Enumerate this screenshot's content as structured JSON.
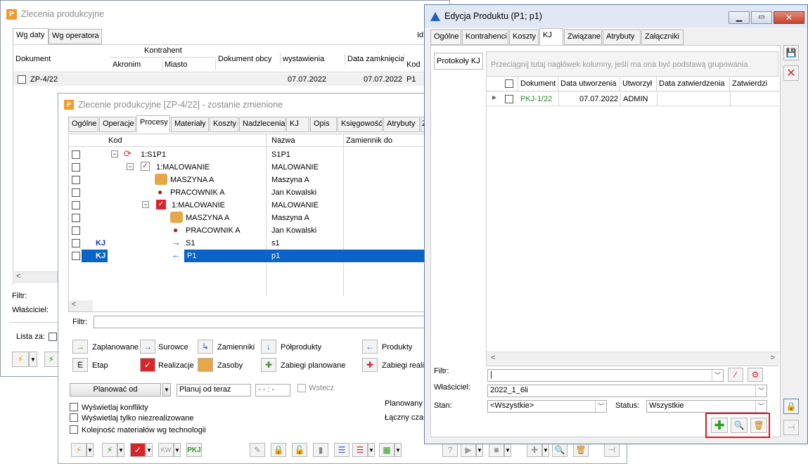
{
  "win1": {
    "title": "Zlecenia produkcyjne",
    "tabs": [
      "Wg daty",
      "Wg operatora"
    ],
    "right_label": "Id",
    "columns": {
      "dokument": "Dokument",
      "kontrahent": "Kontrahent",
      "akronim": "Akronim",
      "miasto": "Miasto",
      "dokument_obcy": "Dokument obcy",
      "wystawienia": "wystawienia",
      "data_zamkniecia": "Data zamknięcia",
      "kod": "Kod"
    },
    "row": {
      "dokument": "ZP-4/22",
      "wystawienia": "07.07.2022",
      "zamkniecia": "07.07.2022",
      "kod": "P1"
    },
    "filtr_label": "Filtr:",
    "wlasciciel_label": "Właściciel:",
    "lista_label": "Lista za:"
  },
  "win2": {
    "title": "Zlecenie produkcyjne  [ZP-4/22] - zostanie zmienione",
    "tabs": [
      "Ogólne",
      "Operacje",
      "Procesy",
      "Materiały",
      "Koszty",
      "Nadzlecenia",
      "KJ",
      "Opis",
      "Księgowość",
      "Atrybuty",
      "Z"
    ],
    "columns": {
      "kod": "Kod",
      "nazwa": "Nazwa",
      "zamiennik": "Zamiennik do"
    },
    "tree": [
      {
        "kod": "1:S1P1",
        "nazwa": "S1P1",
        "kj": ""
      },
      {
        "kod": "1:MALOWANIE",
        "nazwa": "MALOWANIE",
        "kj": ""
      },
      {
        "kod": "MASZYNA A",
        "nazwa": "Maszyna A",
        "kj": ""
      },
      {
        "kod": "PRACOWNIK A",
        "nazwa": "Jan Kowalski",
        "kj": ""
      },
      {
        "kod": "1:MALOWANIE",
        "nazwa": "MALOWANIE",
        "kj": ""
      },
      {
        "kod": "MASZYNA A",
        "nazwa": "Maszyna A",
        "kj": ""
      },
      {
        "kod": "PRACOWNIK A",
        "nazwa": "Jan Kowalski",
        "kj": ""
      },
      {
        "kod": "S1",
        "nazwa": "s1",
        "kj": "KJ"
      },
      {
        "kod": "P1",
        "nazwa": "p1",
        "kj": "KJ"
      }
    ],
    "filtr_label": "Filtr:",
    "legend": {
      "zaplanowane": "Zaplanowane",
      "surowce": "Surowce",
      "zamienniki": "Zamienniki",
      "polprodukty": "Półprodukty",
      "produkty": "Produkty",
      "etap": "Etap",
      "realizacje": "Realizacje",
      "zasoby": "Zasoby",
      "zabiegi_planowane": "Zabiegi planowane",
      "zabiegi_realiz": "Zabiegi realiz"
    },
    "etap_icon_letter": "E",
    "planowac_od": "Planować od",
    "planuj_od": "Planuj od teraz",
    "time_value": "- - : -",
    "wstecz": "Wstecz",
    "checks": [
      "Wyświetlaj konflikty",
      "Wyświetlaj tylko niezrealizowane",
      "Kolejność materiałów wg technologii"
    ],
    "planowany": "Planowany",
    "laczny": "Łączny czas",
    "pkj_label": "PKJ",
    "kw_label": "KW"
  },
  "win3": {
    "title": "Edycja Produktu (P1; p1)",
    "tabs": [
      "Ogólne",
      "Kontrahenci",
      "Koszty",
      "KJ",
      "Związane",
      "Atrybuty",
      "Załączniki"
    ],
    "side_tab": "Protokoły KJ",
    "group_hint": "Przeciągnij tutaj nagłówek kolumny, jeśli ma ona być podstawą grupowania",
    "columns": [
      "Dokument",
      "Data utworzenia",
      "Utworzył",
      "Data zatwierdzenia",
      "Zatwierdzi"
    ],
    "row": {
      "dokument": "PKJ-1/22",
      "data": "07.07.2022",
      "utworzyl": "ADMIN"
    },
    "filtr_label": "Filtr:",
    "wlasciciel_label": "Właściciel:",
    "wlasciciel_value": "2022_1_6li",
    "stan_label": "Stan:",
    "stan_value": "<Wszystkie>",
    "status_label": "Status:",
    "status_value": "Wszystkie",
    "highlight_color": "#e0141e",
    "add_color": "#2e9b20"
  }
}
